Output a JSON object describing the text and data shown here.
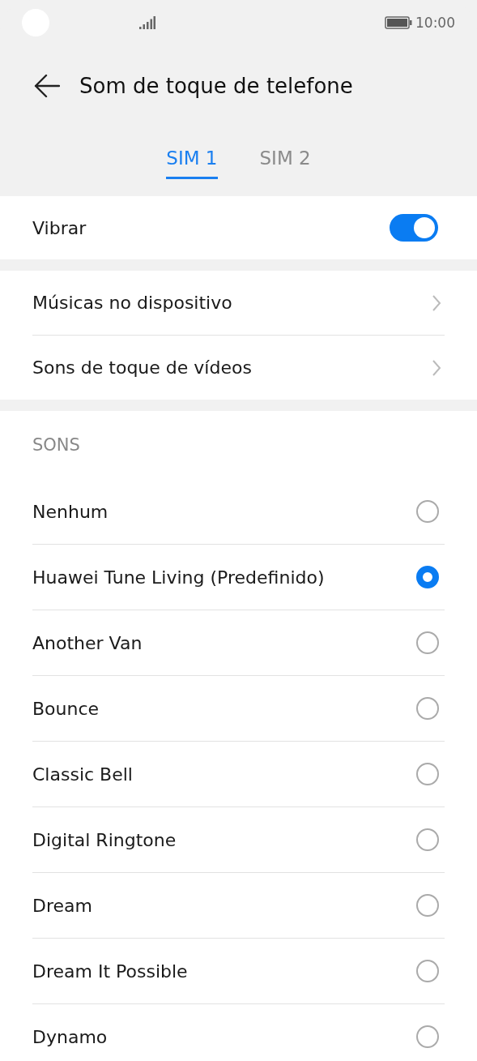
{
  "status_bar": {
    "time": "10:00"
  },
  "header": {
    "title": "Som de toque de telefone"
  },
  "tabs": [
    {
      "label": "SIM 1",
      "selected": true
    },
    {
      "label": "SIM 2",
      "selected": false
    }
  ],
  "vibrate": {
    "label": "Vibrar",
    "on": true
  },
  "links": [
    {
      "label": "Músicas no dispositivo"
    },
    {
      "label": "Sons de toque de vídeos"
    }
  ],
  "sounds": {
    "heading": "SONS",
    "items": [
      {
        "label": "Nenhum",
        "selected": false
      },
      {
        "label": "Huawei Tune Living (Predefinido)",
        "selected": true
      },
      {
        "label": "Another Van",
        "selected": false
      },
      {
        "label": "Bounce",
        "selected": false
      },
      {
        "label": "Classic Bell",
        "selected": false
      },
      {
        "label": "Digital Ringtone",
        "selected": false
      },
      {
        "label": "Dream",
        "selected": false
      },
      {
        "label": "Dream It Possible",
        "selected": false
      },
      {
        "label": "Dynamo",
        "selected": false
      }
    ]
  }
}
